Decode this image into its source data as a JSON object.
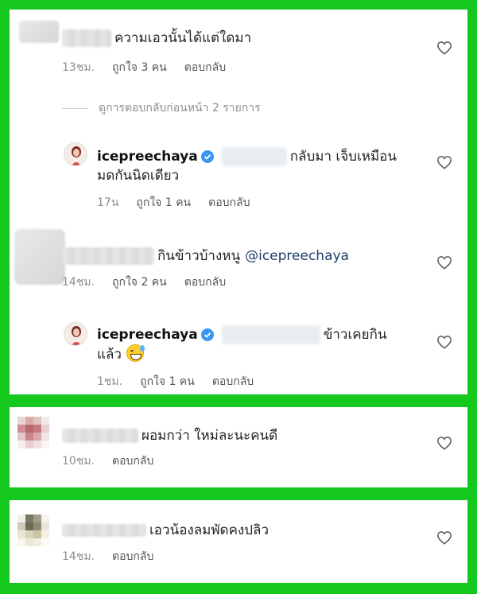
{
  "comments": [
    {
      "text": "ความเอวนั้นได้แต่ใดมา",
      "time": "13ชม.",
      "likes": "ถูกใจ 3 คน",
      "reply": "ตอบกลับ"
    },
    {
      "view_previous": "ดูการตอบกลับก่อนหน้า 2 รายการ"
    },
    {
      "username": "icepreechaya",
      "text_line1": "กลับมา เจ็บเหมือน",
      "text_line2": "มดกันนิดเดียว",
      "time": "17น",
      "likes": "ถูกใจ 1 คน",
      "reply": "ตอบกลับ"
    },
    {
      "text": "กินข้าวบ้างหนู",
      "mention": "@icepreechaya",
      "time": "14ชม.",
      "likes": "ถูกใจ 2 คน",
      "reply": "ตอบกลับ"
    },
    {
      "username": "icepreechaya",
      "text_line1": "ข้าวเคยกิน",
      "text_line2": "แล้ว",
      "emoji": "grinning-sweat-emoji",
      "time": "1ชม.",
      "likes": "ถูกใจ 1 คน",
      "reply": "ตอบกลับ"
    }
  ],
  "comment_b": {
    "text": "ผอมกว่า ใหม่ละนะคนดี",
    "time": "10ชม.",
    "reply": "ตอบกลับ"
  },
  "comment_c": {
    "text": "เอวน้องลมพัดคงปลิว",
    "time": "14ชม.",
    "reply": "ตอบกลับ"
  },
  "colors": {
    "frame": "#14c81e",
    "verified": "#3897f0",
    "mention": "#1d3e6b",
    "meta": "#8e8e8e"
  },
  "icons": [
    "heart-icon",
    "verified-badge-icon"
  ]
}
